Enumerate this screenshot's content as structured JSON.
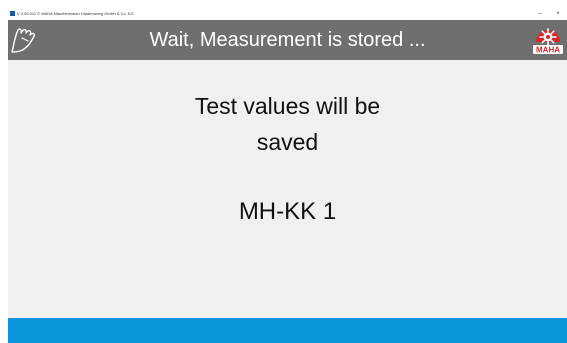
{
  "titlebar": {
    "title": "V 3.09.011  © MAHA Maschinenbau Haldenwang GmbH & Co. KG",
    "min": "–",
    "close": "×"
  },
  "header": {
    "title": "Wait, Measurement is stored ...",
    "logo_text": "MAHA",
    "hand_icon": "hand-icon",
    "bg_color": "#6f6f6f"
  },
  "main": {
    "message_line1": "Test values will be",
    "message_line2": "saved",
    "device_name": "MH-KK 1"
  },
  "footer": {
    "bg_color": "#0a94da"
  }
}
